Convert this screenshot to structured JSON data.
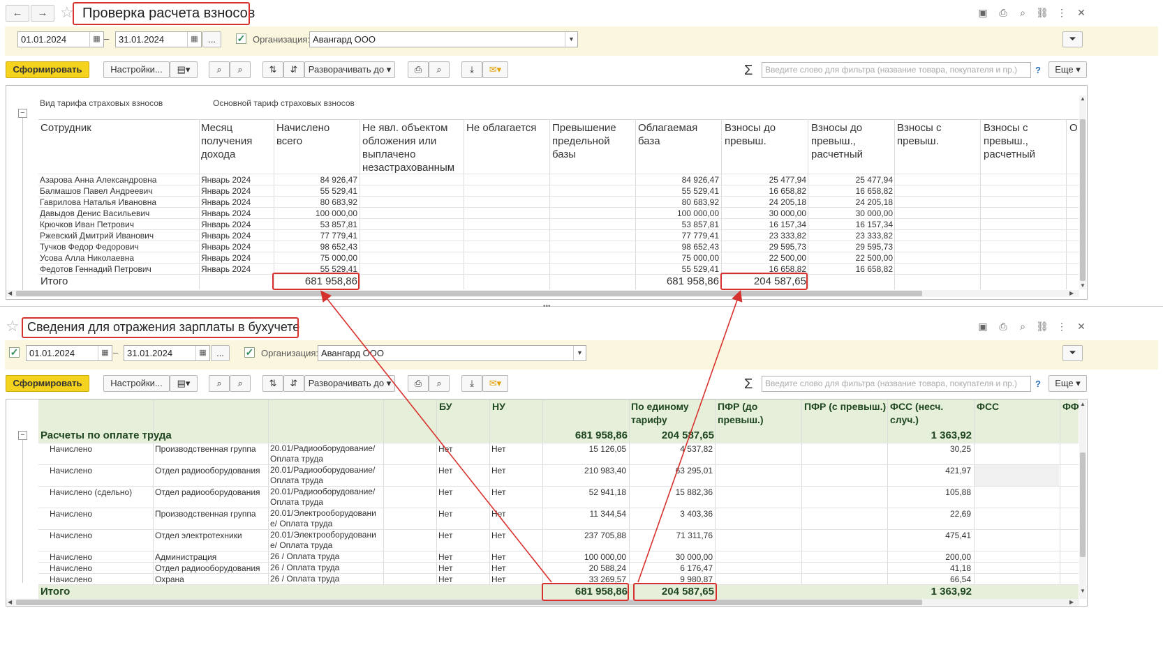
{
  "window1": {
    "title": "Проверка расчета взносов",
    "date_from": "01.01.2024",
    "date_to": "31.01.2024",
    "dots_label": "...",
    "org_label": "Организация:",
    "org_value": "Авангард ООО",
    "generate_label": "Сформировать",
    "settings_label": "Настройки...",
    "expand_label": "Разворачивать до",
    "search_placeholder": "Введите слово для фильтра (название товара, покупателя и пр.)",
    "help_label": "?",
    "more_label": "Еще",
    "tariff_label": "Вид тарифа страховых взносов",
    "tariff_value": "Основной тариф страховых взносов",
    "columns": [
      "Сотрудник",
      "Месяц получения дохода",
      "Начислено всего",
      "Не явл. объектом обложения или выплачено незастрахованным",
      "Не облагается",
      "Превышение предельной базы",
      "Облагаемая база",
      "Взносы до превыш.",
      "Взносы до превыш., расчетный",
      "Взносы с превыш.",
      "Взносы с превыш., расчетный",
      "О"
    ],
    "rows": [
      {
        "name": "Азарова Анна Александровна",
        "month": "Январь 2024",
        "accrued": "84 926,47",
        "base": "84 926,47",
        "contrib": "25 477,94",
        "calc": "25 477,94"
      },
      {
        "name": "Балмашов Павел Андреевич",
        "month": "Январь 2024",
        "accrued": "55 529,41",
        "base": "55 529,41",
        "contrib": "16 658,82",
        "calc": "16 658,82"
      },
      {
        "name": "Гаврилова Наталья Ивановна",
        "month": "Январь 2024",
        "accrued": "80 683,92",
        "base": "80 683,92",
        "contrib": "24 205,18",
        "calc": "24 205,18"
      },
      {
        "name": "Давыдов Денис Васильевич",
        "month": "Январь 2024",
        "accrued": "100 000,00",
        "base": "100 000,00",
        "contrib": "30 000,00",
        "calc": "30 000,00"
      },
      {
        "name": "Крючков Иван Петрович",
        "month": "Январь 2024",
        "accrued": "53 857,81",
        "base": "53 857,81",
        "contrib": "16 157,34",
        "calc": "16 157,34"
      },
      {
        "name": "Ржевский Дмитрий Иванович",
        "month": "Январь 2024",
        "accrued": "77 779,41",
        "base": "77 779,41",
        "contrib": "23 333,82",
        "calc": "23 333,82"
      },
      {
        "name": "Тучков Федор Федорович",
        "month": "Январь 2024",
        "accrued": "98 652,43",
        "base": "98 652,43",
        "contrib": "29 595,73",
        "calc": "29 595,73"
      },
      {
        "name": "Усова Алла Николаевна",
        "month": "Январь 2024",
        "accrued": "75 000,00",
        "base": "75 000,00",
        "contrib": "22 500,00",
        "calc": "22 500,00"
      },
      {
        "name": "Федотов Геннадий Петрович",
        "month": "Январь 2024",
        "accrued": "55 529,41",
        "base": "55 529,41",
        "contrib": "16 658,82",
        "calc": "16 658,82"
      }
    ],
    "total": {
      "label": "Итого",
      "accrued": "681 958,86",
      "base": "681 958,86",
      "contrib": "204 587,65"
    }
  },
  "window2": {
    "title": "Сведения для отражения зарплаты в бухучете",
    "date_from": "01.01.2024",
    "date_to": "31.01.2024",
    "dots_label": "...",
    "org_label": "Организация:",
    "org_value": "Авангард ООО",
    "generate_label": "Сформировать",
    "settings_label": "Настройки...",
    "expand_label": "Разворачивать до",
    "search_placeholder": "Введите слово для фильтра (название товара, покупателя и пр.)",
    "help_label": "?",
    "more_label": "Еще",
    "columns": [
      "БУ",
      "НУ",
      "По единому тарифу",
      "ПФР (до превыш.)",
      "ПФР (с превыш.)",
      "ФСС (несч. случ.)",
      "ФСС",
      "ФФ"
    ],
    "group": {
      "label": "Расчеты по оплате труда",
      "amount": "681 958,86",
      "single": "204 587,65",
      "fss": "1 363,92"
    },
    "rows": [
      {
        "type": "Начислено",
        "dept": "Производственная группа",
        "account": "20.01/Радиооборудование/ Оплата труда",
        "bu": "Нет",
        "nu": "Нет",
        "amount": "15 126,05",
        "single": "4 537,82",
        "fss": "30,25"
      },
      {
        "type": "Начислено",
        "dept": "Отдел радиооборудования",
        "account": "20.01/Радиооборудование/ Оплата труда",
        "bu": "Нет",
        "nu": "Нет",
        "amount": "210 983,40",
        "single": "63 295,01",
        "fss": "421,97"
      },
      {
        "type": "Начислено (сдельно)",
        "dept": "Отдел радиооборудования",
        "account": "20.01/Радиооборудование/ Оплата труда",
        "bu": "Нет",
        "nu": "Нет",
        "amount": "52 941,18",
        "single": "15 882,36",
        "fss": "105,88"
      },
      {
        "type": "Начислено",
        "dept": "Производственная группа",
        "account": "20.01/Электрооборудовани е/ Оплата труда",
        "bu": "Нет",
        "nu": "Нет",
        "amount": "11 344,54",
        "single": "3 403,36",
        "fss": "22,69"
      },
      {
        "type": "Начислено",
        "dept": "Отдел электротехники",
        "account": "20.01/Электрооборудовани е/ Оплата труда",
        "bu": "Нет",
        "nu": "Нет",
        "amount": "237 705,88",
        "single": "71 311,76",
        "fss": "475,41"
      },
      {
        "type": "Начислено",
        "dept": "Администрация",
        "account": "26 / Оплата труда",
        "bu": "Нет",
        "nu": "Нет",
        "amount": "100 000,00",
        "single": "30 000,00",
        "fss": "200,00"
      },
      {
        "type": "Начислено",
        "dept": "Отдел радиооборудования",
        "account": "26 / Оплата труда",
        "bu": "Нет",
        "nu": "Нет",
        "amount": "20 588,24",
        "single": "6 176,47",
        "fss": "41,18"
      },
      {
        "type": "Начислено",
        "dept": "Охрана",
        "account": "26 / Оплата труда",
        "bu": "Нет",
        "nu": "Нет",
        "amount": "33 269,57",
        "single": "9 980,87",
        "fss": "66,54"
      }
    ],
    "total": {
      "label": "Итого",
      "amount": "681 958,86",
      "single": "204 587,65",
      "fss": "1 363,92"
    }
  },
  "icons": [
    "back-arrow-icon",
    "forward-arrow-icon",
    "star-icon",
    "save-icon",
    "print-icon",
    "preview-icon",
    "link-icon",
    "more-vert-icon",
    "close-icon",
    "calendar-icon",
    "filter-icon",
    "variants-icon",
    "search-icon",
    "search-advanced-icon",
    "sort-asc-icon",
    "sort-desc-icon",
    "printer-icon",
    "print-preview-icon",
    "download-icon",
    "email-icon",
    "sigma-icon",
    "collapse-icon"
  ],
  "accent_color": "#d7312d",
  "highlight_color": "#e8f2df",
  "button_color": "#f4d21e"
}
